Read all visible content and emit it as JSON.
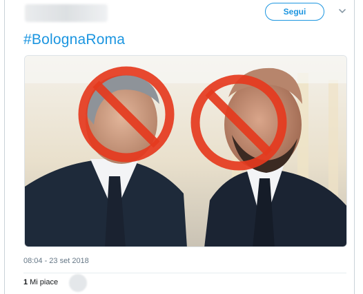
{
  "tweet": {
    "follow_label": "Segui",
    "hashtag": "#BolognaRoma",
    "timestamp": "08:04 - 23 set 2018",
    "likes_count": "1",
    "likes_label": "Mi piace"
  },
  "icons": {
    "more": "chevron-down-icon",
    "prohibition": "no-symbol-icon"
  },
  "colors": {
    "accent": "#1b95e0",
    "prohibition_red": "#e53a1e",
    "suit": "#1e2a3a"
  }
}
